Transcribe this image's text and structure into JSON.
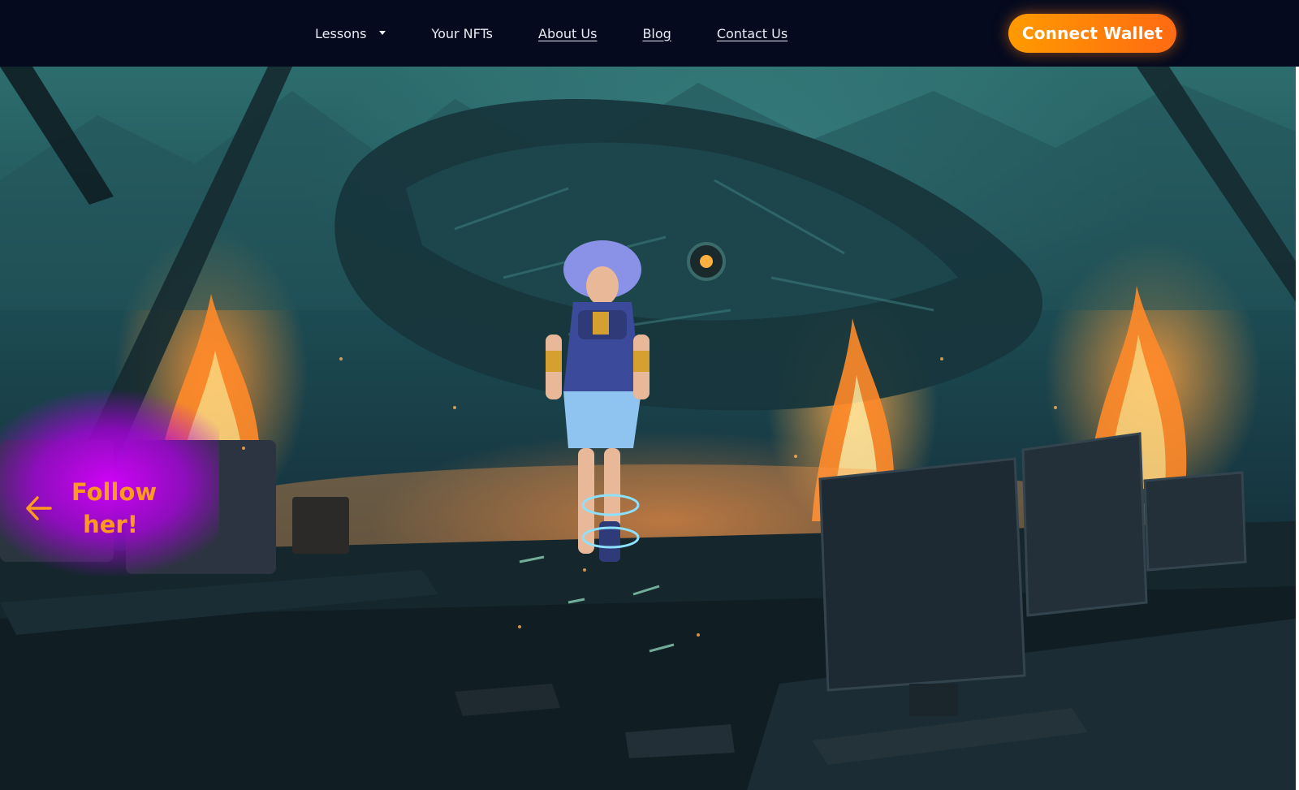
{
  "nav": {
    "items": [
      {
        "label": "Lessons",
        "dropdown": true,
        "underlined": false
      },
      {
        "label": "Your NFTs",
        "dropdown": false,
        "underlined": false
      },
      {
        "label": "About Us",
        "dropdown": false,
        "underlined": true
      },
      {
        "label": "Blog",
        "dropdown": false,
        "underlined": true
      },
      {
        "label": "Contact Us",
        "dropdown": false,
        "underlined": true
      }
    ],
    "connect_button": "Connect Wallet"
  },
  "hero": {
    "follow_line1": "Follow",
    "follow_line2": "her!",
    "follow_icon": "arrow-left-icon"
  },
  "colors": {
    "nav_bg": "#050a1e",
    "button_gradient_start": "#ff9a00",
    "button_gradient_end": "#ff6a12",
    "follow_text": "#ff9a1e",
    "follow_glow": "#d400ff"
  }
}
